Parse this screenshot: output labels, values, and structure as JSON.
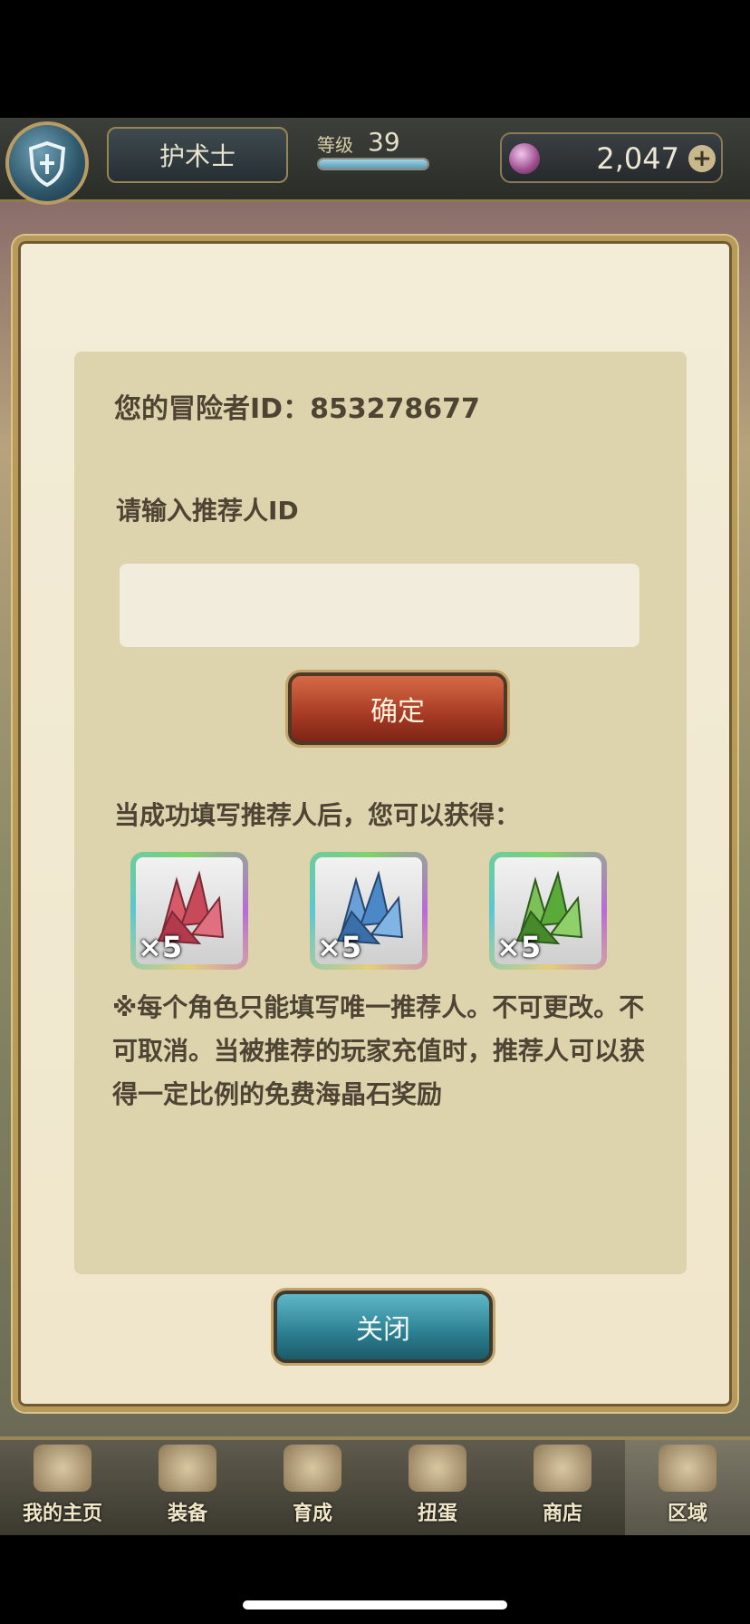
{
  "header": {
    "class_name": "护术士",
    "level_label": "等级",
    "level_value": "39",
    "level_progress_percent": 100,
    "currency_amount": "2,047",
    "currency_icon": "crystal-gem-icon",
    "add_currency_icon": "plus-icon"
  },
  "dialog": {
    "adventurer_id_text": "您的冒险者ID：853278677",
    "referrer_prompt": "请输入推荐人ID",
    "referrer_input_value": "",
    "confirm_label": "确定",
    "reward_title": "当成功填写推荐人后，您可以获得：",
    "rewards": [
      {
        "icon": "red-crystal-icon",
        "color": "#c84a5a",
        "qty": "×5"
      },
      {
        "icon": "blue-crystal-icon",
        "color": "#4a88c8",
        "qty": "×5"
      },
      {
        "icon": "green-crystal-icon",
        "color": "#5aaa3a",
        "qty": "×5"
      }
    ],
    "note": "※每个角色只能填写唯一推荐人。不可更改。不可取消。当被推荐的玩家充值时，推荐人可以获得一定比例的免费海晶石奖励",
    "close_label": "关闭"
  },
  "bottom_nav": [
    {
      "label": "我的主页",
      "icon": "scroll-icon"
    },
    {
      "label": "装备",
      "icon": "helmet-icon"
    },
    {
      "label": "育成",
      "icon": "sword-icon"
    },
    {
      "label": "扭蛋",
      "icon": "gacha-icon"
    },
    {
      "label": "商店",
      "icon": "shop-icon"
    },
    {
      "label": "区域",
      "icon": "globe-icon"
    }
  ]
}
